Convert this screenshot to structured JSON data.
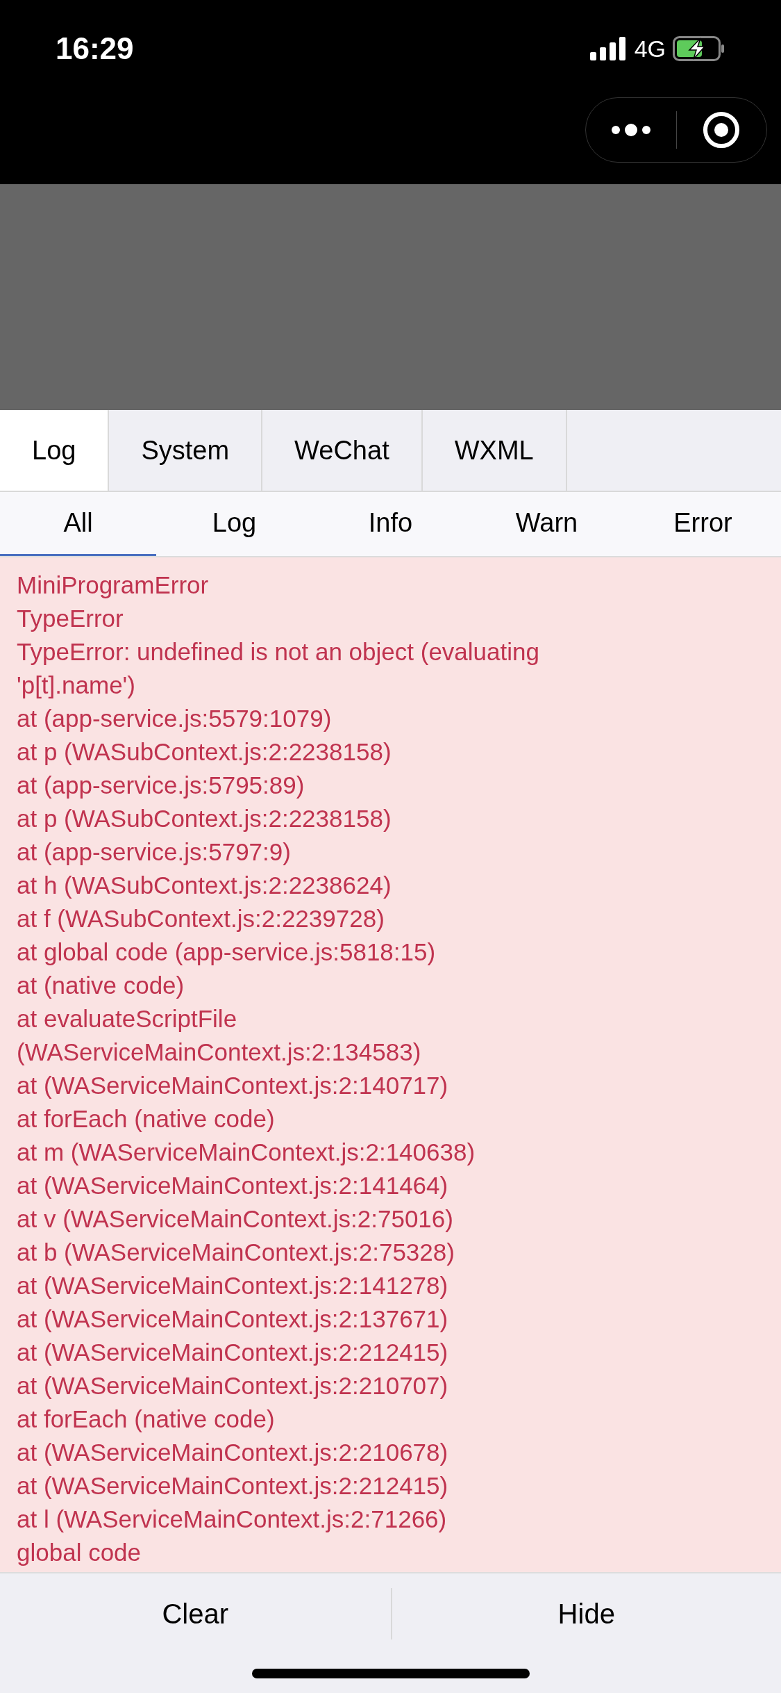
{
  "status_bar": {
    "time": "16:29",
    "network": "4G"
  },
  "tabs": [
    {
      "label": "Log",
      "selected": true
    },
    {
      "label": "System",
      "selected": false
    },
    {
      "label": "WeChat",
      "selected": false
    },
    {
      "label": "WXML",
      "selected": false
    }
  ],
  "filters": [
    {
      "label": "All",
      "selected": true
    },
    {
      "label": "Log",
      "selected": false
    },
    {
      "label": "Info",
      "selected": false
    },
    {
      "label": "Warn",
      "selected": false
    },
    {
      "label": "Error",
      "selected": false
    }
  ],
  "log_lines": [
    "MiniProgramError",
    "TypeError",
    "TypeError: undefined is not an object (evaluating",
    "'p[t].name')",
    "at (app-service.js:5579:1079)",
    "at p (WASubContext.js:2:2238158)",
    "at (app-service.js:5795:89)",
    "at p (WASubContext.js:2:2238158)",
    "at (app-service.js:5797:9)",
    "at h (WASubContext.js:2:2238624)",
    "at f (WASubContext.js:2:2239728)",
    "at global code (app-service.js:5818:15)",
    "at (native code)",
    "at evaluateScriptFile",
    "(WAServiceMainContext.js:2:134583)",
    "at (WAServiceMainContext.js:2:140717)",
    "at forEach (native code)",
    "at m (WAServiceMainContext.js:2:140638)",
    "at (WAServiceMainContext.js:2:141464)",
    "at v (WAServiceMainContext.js:2:75016)",
    "at b (WAServiceMainContext.js:2:75328)",
    "at (WAServiceMainContext.js:2:141278)",
    "at (WAServiceMainContext.js:2:137671)",
    "at (WAServiceMainContext.js:2:212415)",
    "at (WAServiceMainContext.js:2:210707)",
    "at forEach (native code)",
    "at (WAServiceMainContext.js:2:210678)",
    "at (WAServiceMainContext.js:2:212415)",
    "at l (WAServiceMainContext.js:2:71266)",
    "global code"
  ],
  "buttons": [
    "Clear",
    "Hide"
  ]
}
